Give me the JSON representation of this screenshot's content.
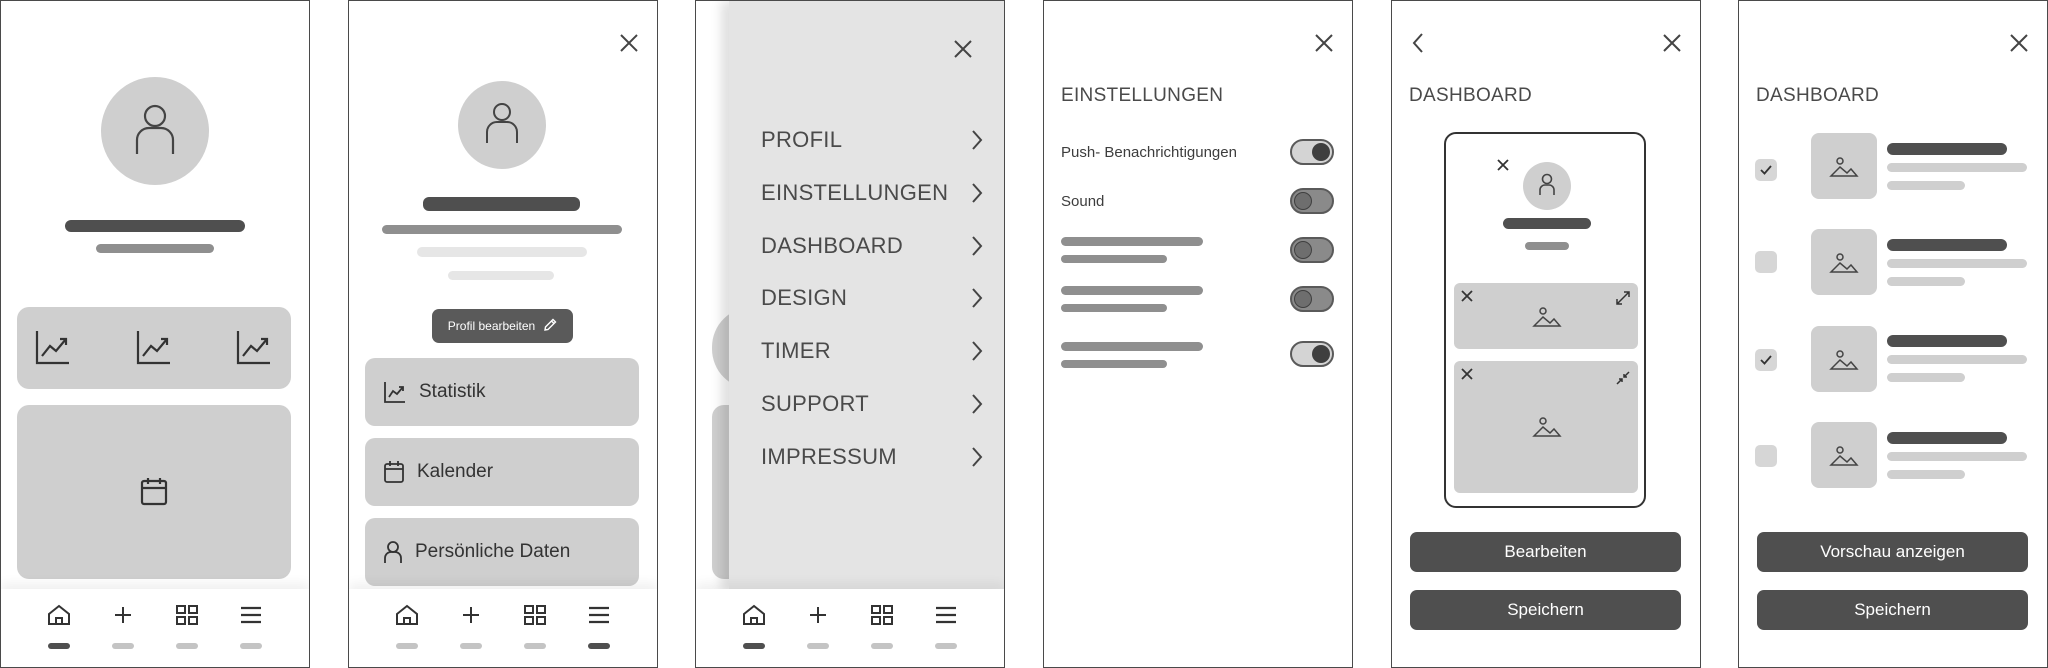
{
  "screens": {
    "profile_edit": {
      "edit_button": "Profil bearbeiten",
      "buttons": [
        "Statistik",
        "Kalender",
        "Persönliche Daten"
      ]
    },
    "menu": {
      "items": [
        "PROFIL",
        "EINSTELLUNGEN",
        "DASHBOARD",
        "DESIGN",
        "TIMER",
        "SUPPORT",
        "IMPRESSUM"
      ]
    },
    "settings": {
      "title": "EINSTELLUNGEN",
      "labels": [
        "Push- Benachrichtigungen",
        "Sound"
      ],
      "toggles": [
        "on",
        "off",
        "off",
        "off",
        "on"
      ]
    },
    "dashboard_edit": {
      "title": "DASHBOARD",
      "primary_button": "Bearbeiten",
      "secondary_button": "Speichern"
    },
    "dashboard_select": {
      "title": "DASHBOARD",
      "checked": [
        true,
        false,
        true,
        false
      ],
      "primary_button": "Vorschau anzeigen",
      "secondary_button": "Speichern"
    }
  },
  "icons": [
    "home-icon",
    "plus-icon",
    "grid-icon",
    "menu-icon",
    "close-icon",
    "chevron-right-icon",
    "chevron-left-icon",
    "trend-chart-icon",
    "calendar-icon",
    "user-icon",
    "pencil-icon",
    "image-icon",
    "expand-icon",
    "collapse-icon",
    "check-icon"
  ],
  "colors": {
    "dark": "#4f4f4f",
    "mid": "#8f8f8f",
    "light": "#cfcfcf",
    "outline": "#4a4a4a"
  }
}
